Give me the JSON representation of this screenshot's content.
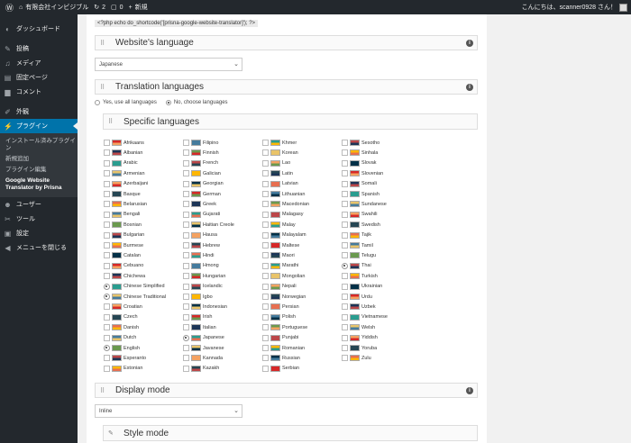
{
  "admin_bar": {
    "site_name": "有限会社インビジブル",
    "updates_count": "2",
    "comments_count": "0",
    "new_label": "新規",
    "greeting": "こんにちは、scanner0928 さん！"
  },
  "sidebar": {
    "items_top": [
      {
        "label": "ダッシュボード",
        "icon": "gauge-icon"
      }
    ],
    "items_mid": [
      {
        "label": "投稿",
        "icon": "pin-icon"
      },
      {
        "label": "メディア",
        "icon": "media-icon"
      },
      {
        "label": "固定ページ",
        "icon": "page-icon"
      },
      {
        "label": "コメント",
        "icon": "comment-icon"
      }
    ],
    "items_appearance": [
      {
        "label": "外観",
        "icon": "brush-icon"
      }
    ],
    "current": {
      "label": "プラグイン",
      "icon": "plug-icon"
    },
    "submenu": [
      "インストール済みプラグイン",
      "新規追加",
      "プラグイン編集",
      "Google Website Translator by Prisna"
    ],
    "items_bottom": [
      {
        "label": "ユーザー",
        "icon": "user-icon"
      },
      {
        "label": "ツール",
        "icon": "wrench-icon"
      },
      {
        "label": "設定",
        "icon": "settings-icon"
      },
      {
        "label": "メニューを閉じる",
        "icon": "collapse-icon"
      }
    ]
  },
  "content": {
    "shortcode": "<?php echo do_shortcode('[prisna-google-website-translator]'); ?>",
    "website_language": {
      "title": "Website's language",
      "value": "Japanese"
    },
    "translation_languages": {
      "title": "Translation languages",
      "option_all": "Yes, use all languages",
      "option_choose": "No, choose languages",
      "selected": "choose"
    },
    "specific_languages": {
      "title": "Specific languages"
    },
    "display_mode": {
      "title": "Display mode",
      "value": "Inline"
    },
    "style_mode": {
      "title": "Style mode"
    }
  },
  "languages": [
    [
      "Afrikaans",
      "Albanian",
      "Arabic",
      "Armenian",
      "Azerbaijani",
      "Basque",
      "Belarusian",
      "Bengali",
      "Bosnian",
      "Bulgarian",
      "Burmese",
      "Catalan",
      "Cebuano",
      "Chichewa",
      "Chinese Simplified",
      "Chinese Traditional",
      "Croatian",
      "Czech",
      "Danish",
      "Dutch",
      "English",
      "Esperanto",
      "Estonian"
    ],
    [
      "Filipino",
      "Finnish",
      "French",
      "Galician",
      "Georgian",
      "German",
      "Greek",
      "Gujarati",
      "Haitian Creole",
      "Hausa",
      "Hebrew",
      "Hindi",
      "Hmong",
      "Hungarian",
      "Icelandic",
      "Igbo",
      "Indonesian",
      "Irish",
      "Italian",
      "Japanese",
      "Javanese",
      "Kannada",
      "Kazakh"
    ],
    [
      "Khmer",
      "Korean",
      "Lao",
      "Latin",
      "Latvian",
      "Lithuanian",
      "Macedonian",
      "Malagasy",
      "Malay",
      "Malayalam",
      "Maltese",
      "Maori",
      "Marathi",
      "Mongolian",
      "Nepali",
      "Norwegian",
      "Persian",
      "Polish",
      "Portuguese",
      "Punjabi",
      "Romanian",
      "Russian",
      "Serbian"
    ],
    [
      "Sesotho",
      "Sinhala",
      "Slovak",
      "Slovenian",
      "Somali",
      "Spanish",
      "Sundanese",
      "Swahili",
      "Swedish",
      "Tajik",
      "Tamil",
      "Telugu",
      "Thai",
      "Turkish",
      "Ukrainian",
      "Urdu",
      "Uzbek",
      "Vietnamese",
      "Welsh",
      "Yiddish",
      "Yoruba",
      "Zulu"
    ]
  ],
  "selected_languages": [
    "Chinese Simplified",
    "Chinese Traditional",
    "English",
    "Japanese",
    "Thai"
  ],
  "flag_colors": [
    "#d62828",
    "#1d3557",
    "#2a9d8f",
    "#e9c46a",
    "#f4a261",
    "#264653",
    "#e76f51",
    "#457b9d",
    "#6a994e",
    "#bc4749",
    "#ffb703",
    "#023047"
  ]
}
